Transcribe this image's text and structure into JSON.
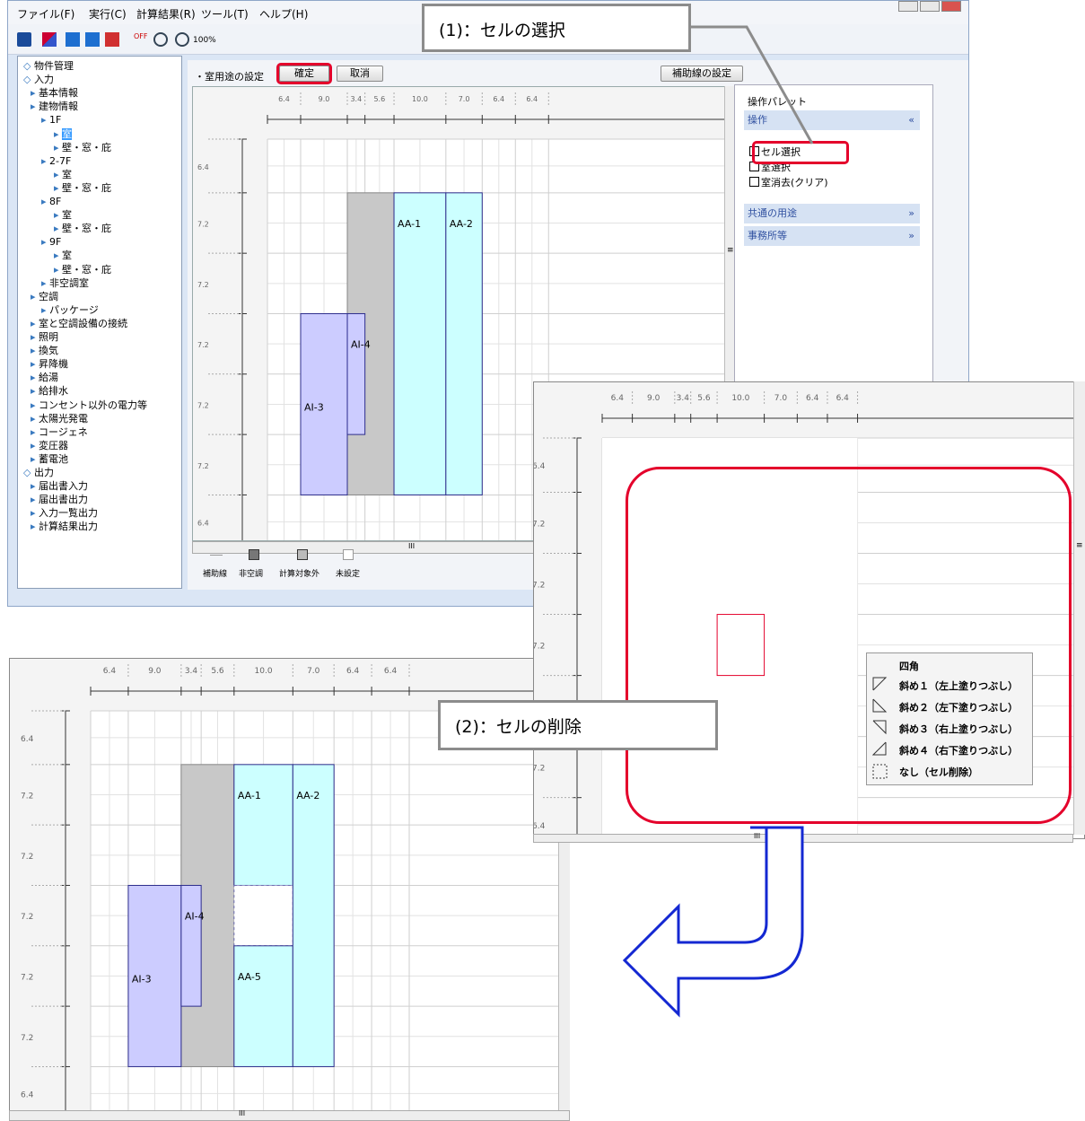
{
  "menu": [
    "ファイル(F)",
    "実行(C)",
    "計算結果(R)",
    "ツール(T)",
    "ヘルプ(H)"
  ],
  "toolbar": {
    "zoom": "100%",
    "off_label": "OFF"
  },
  "tree": [
    {
      "label": "物件管理",
      "level": 0
    },
    {
      "label": "入力",
      "level": 0
    },
    {
      "label": "基本情報",
      "level": 1
    },
    {
      "label": "建物情報",
      "level": 1
    },
    {
      "label": "1F",
      "level": 2
    },
    {
      "label": "室",
      "level": 3,
      "selected": true
    },
    {
      "label": "壁・窓・庇",
      "level": 3
    },
    {
      "label": "2-7F",
      "level": 2
    },
    {
      "label": "室",
      "level": 3
    },
    {
      "label": "壁・窓・庇",
      "level": 3
    },
    {
      "label": "8F",
      "level": 2
    },
    {
      "label": "室",
      "level": 3
    },
    {
      "label": "壁・窓・庇",
      "level": 3
    },
    {
      "label": "9F",
      "level": 2
    },
    {
      "label": "室",
      "level": 3
    },
    {
      "label": "壁・窓・庇",
      "level": 3
    },
    {
      "label": "非空調室",
      "level": 2
    },
    {
      "label": "空調",
      "level": 1
    },
    {
      "label": "パッケージ",
      "level": 2
    },
    {
      "label": "室と空調設備の接続",
      "level": 1
    },
    {
      "label": "照明",
      "level": 1
    },
    {
      "label": "換気",
      "level": 1
    },
    {
      "label": "昇降機",
      "level": 1
    },
    {
      "label": "給湯",
      "level": 1
    },
    {
      "label": "給排水",
      "level": 1
    },
    {
      "label": "コンセント以外の電力等",
      "level": 1
    },
    {
      "label": "太陽光発電",
      "level": 1
    },
    {
      "label": "コージェネ",
      "level": 1
    },
    {
      "label": "変圧器",
      "level": 1
    },
    {
      "label": "蓄電池",
      "level": 1
    },
    {
      "label": "出力",
      "level": 0
    },
    {
      "label": "届出書入力",
      "level": 1
    },
    {
      "label": "届出書出力",
      "level": 1
    },
    {
      "label": "入力一覧出力",
      "level": 1
    },
    {
      "label": "計算結果出力",
      "level": 1
    }
  ],
  "editor": {
    "title": "・室用途の設定",
    "confirm": "確定",
    "cancel": "取消",
    "aux_settings": "補助線の設定",
    "col_widths": [
      "6.4",
      "9.0",
      "3.4",
      "5.6",
      "10.0",
      "7.0",
      "6.4",
      "6.4"
    ],
    "row_heights": [
      "6.4",
      "7.2",
      "7.2",
      "7.2",
      "7.2",
      "7.2",
      "6.4"
    ],
    "scroll_mark": "III",
    "scroll_mark_v": "≡"
  },
  "rooms_top": [
    {
      "name": "AA-1"
    },
    {
      "name": "AA-2"
    },
    {
      "name": "AI-4"
    },
    {
      "name": "AI-3"
    }
  ],
  "rooms_bottom": [
    {
      "name": "AA-1"
    },
    {
      "name": "AA-2"
    },
    {
      "name": "AI-4"
    },
    {
      "name": "AI-3"
    },
    {
      "name": "AA-5"
    }
  ],
  "legend": [
    {
      "label": "補助線"
    },
    {
      "label": "非空調"
    },
    {
      "label": "計算対象外"
    },
    {
      "label": "未設定"
    }
  ],
  "palette": {
    "title": "操作パレット",
    "ops_header": "操作",
    "options": [
      "セル選択",
      "室選択",
      "室消去(クリア)"
    ],
    "common_use": "共通の用途",
    "office": "事務所等"
  },
  "callouts": {
    "select_cell": "(1)：セルの選択",
    "delete_cell": "(2)：セルの削除"
  },
  "context_menu": {
    "header": "四角",
    "items": [
      "斜め１（左上塗りつぶし）",
      "斜め２（左下塗りつぶし）",
      "斜め３（右上塗りつぶし）",
      "斜め４（右下塗りつぶし）",
      "なし（セル削除）"
    ]
  },
  "colors": {
    "room_purple": "#ccccff",
    "room_cyan": "#ccffff",
    "non_ac": "#c8c8c8",
    "highlight": "#e4002b",
    "arrow_blue": "#1428d2"
  }
}
